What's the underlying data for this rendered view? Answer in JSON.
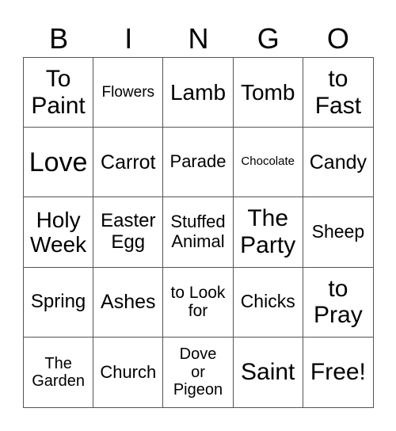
{
  "header": {
    "letters": [
      "B",
      "I",
      "N",
      "G",
      "O"
    ]
  },
  "cells": [
    "To Paint",
    "Flowers",
    "Lamb",
    "Tomb",
    "to Fast",
    "Love",
    "Carrot",
    "Parade",
    "Chocolate",
    "Candy",
    "Holy Week",
    "Easter Egg",
    "Stuffed Animal",
    "The Party",
    "Sheep",
    "Spring",
    "Ashes",
    "to Look for",
    "Chicks",
    "to Pray",
    "The Garden",
    "Church",
    "Dove or Pigeon",
    "Saint",
    "Free!"
  ]
}
